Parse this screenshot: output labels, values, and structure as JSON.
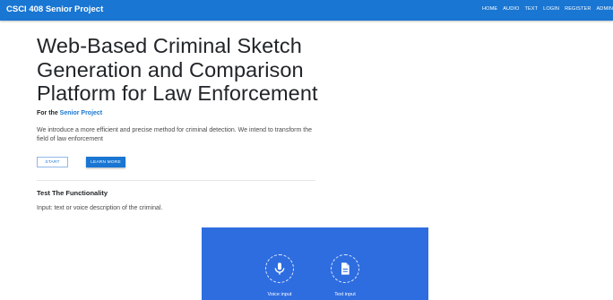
{
  "navbar": {
    "brand": "CSCI 408 Senior Project",
    "links": [
      "HOME",
      "AUDIO",
      "TEXT",
      "LOGIN",
      "REGISTER",
      "ADMIN"
    ]
  },
  "hero": {
    "headline_lines": [
      "Web-Based Criminal Sketch",
      "Generation and Comparison",
      "Platform for Law Enforcement"
    ],
    "subtitle_prefix": "For the ",
    "subtitle_link": "Senior Project",
    "intro": "We introduce a more efficient and precise method for criminal detection. We intend to transform the field of law enforcement",
    "start_button": "START",
    "learn_more_button": "LEARN MORE"
  },
  "functionality": {
    "title": "Test The Functionality",
    "description": "Input: text or voice description of the criminal."
  },
  "inputs": {
    "voice_label": "Voice input",
    "voice_icon": "microphone-icon",
    "text_label": "Text input",
    "text_icon": "document-icon"
  },
  "colors": {
    "primary": "#1976d2",
    "panel": "#2e6de0"
  }
}
